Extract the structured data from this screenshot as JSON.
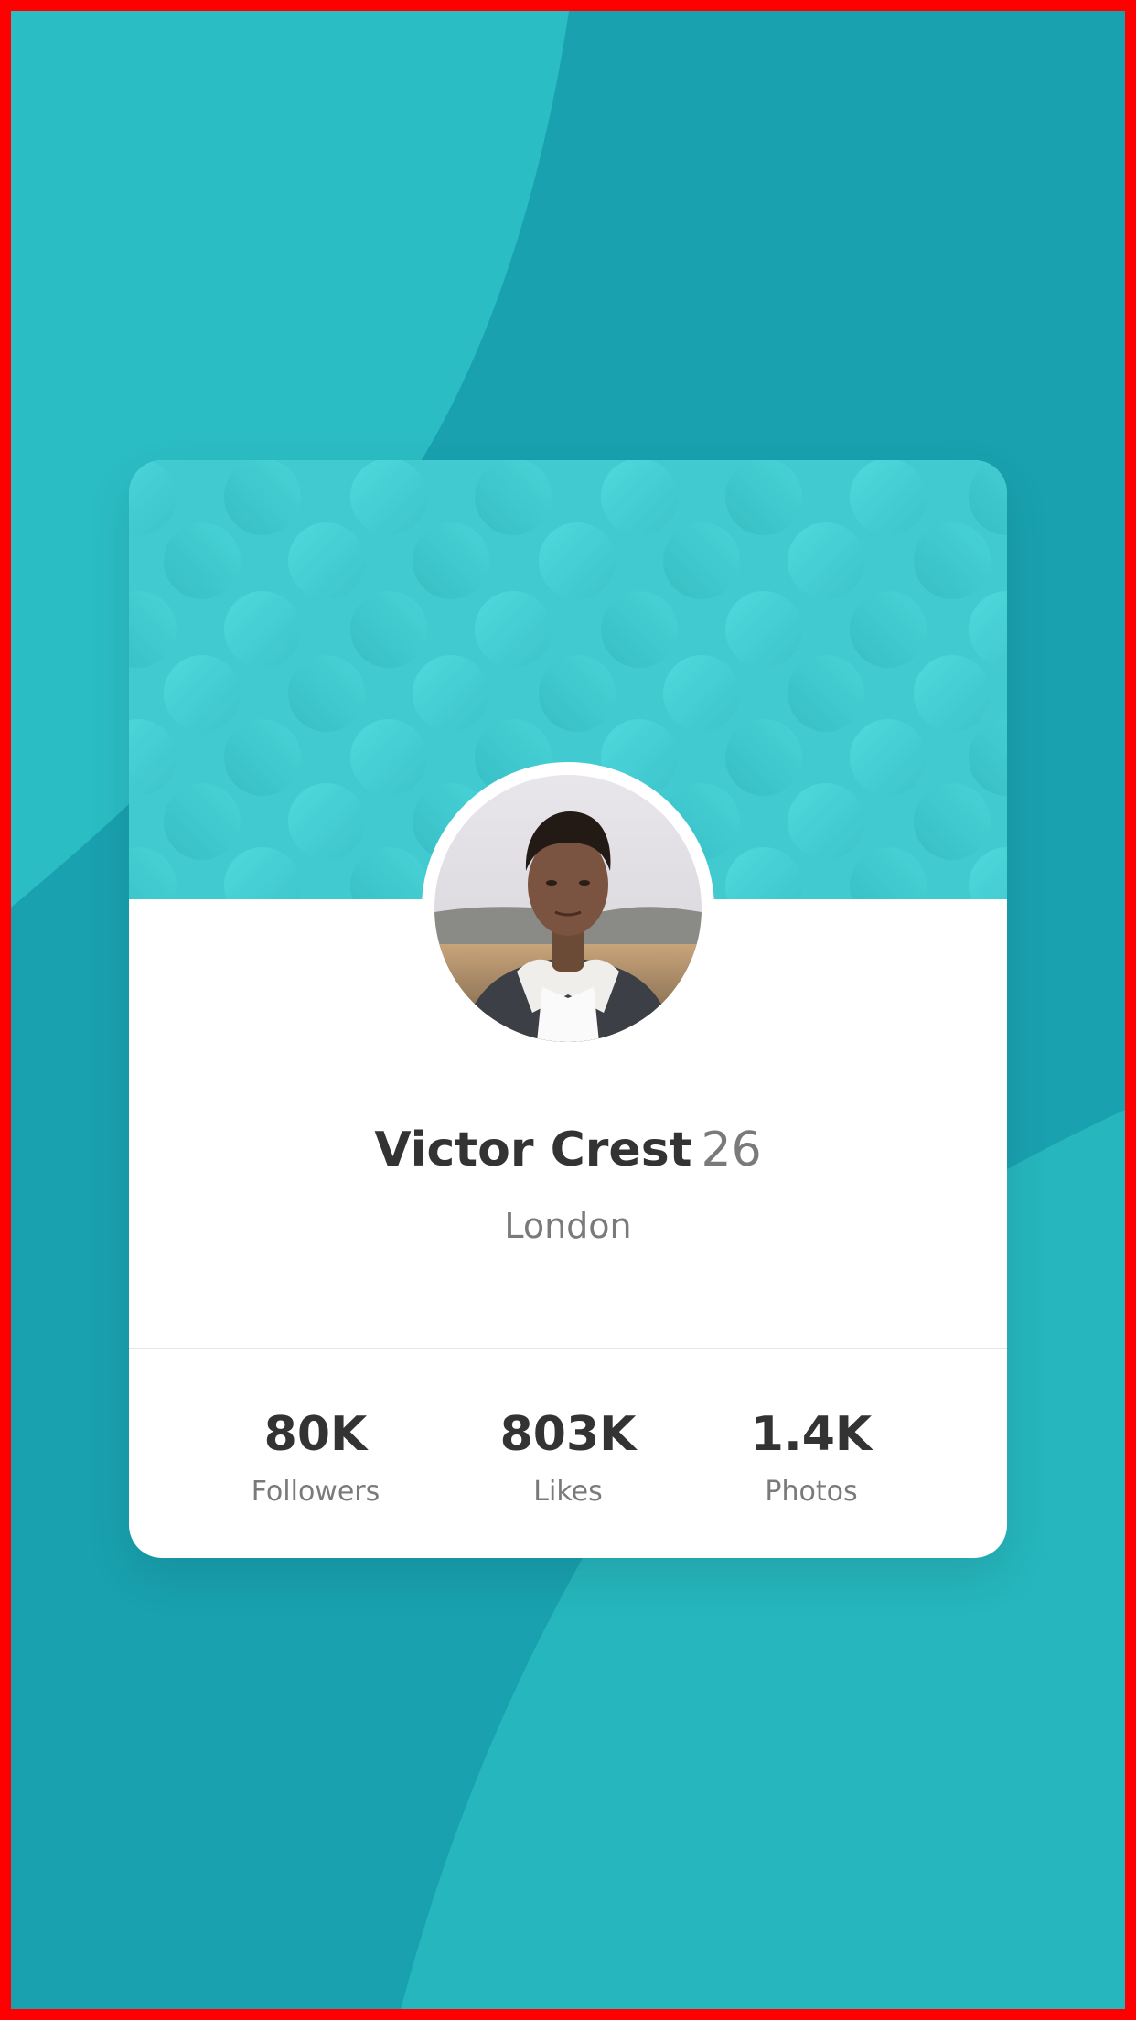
{
  "profile": {
    "name": "Victor Crest",
    "age": "26",
    "location": "London"
  },
  "stats": [
    {
      "value": "80K",
      "label": "Followers"
    },
    {
      "value": "803K",
      "label": "Likes"
    },
    {
      "value": "1.4K",
      "label": "Photos"
    }
  ],
  "colors": {
    "background": "#19a1af",
    "background_shape": "#2bbdc4",
    "card_header": "#42ccd2",
    "card": "#ffffff",
    "primary_text": "#333333",
    "secondary_text": "#7a7a7a",
    "border": "#ff0000"
  }
}
